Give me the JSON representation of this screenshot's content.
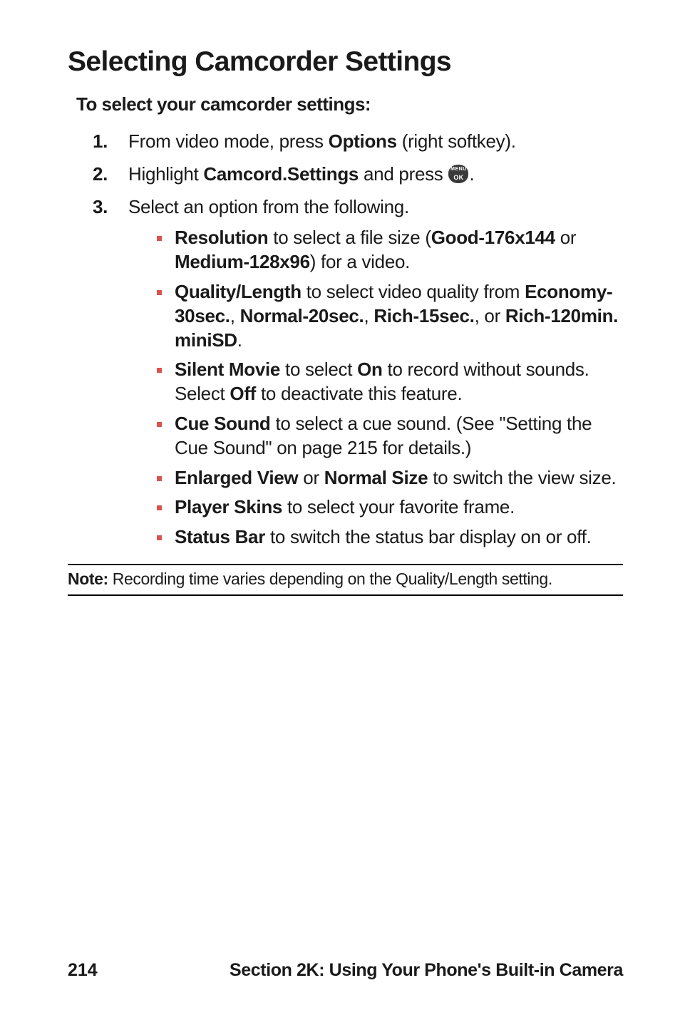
{
  "heading": "Selecting Camcorder Settings",
  "subheading": "To select your camcorder settings:",
  "step1": {
    "pre": "From video mode, press ",
    "bold": "Options",
    "post": " (right softkey)."
  },
  "step2": {
    "pre": "Highlight ",
    "bold": "Camcord.Settings",
    "mid": " and press ",
    "icon_top": "MENU",
    "icon_bot": "OK",
    "post": "."
  },
  "step3": {
    "text": "Select an option from the following."
  },
  "bullets": {
    "resolution": {
      "b1": "Resolution",
      "t1": " to select a file size (",
      "b2": "Good-176x144",
      "t2": " or ",
      "b3": "Medium-128x96",
      "t3": ") for a video."
    },
    "quality": {
      "b1": "Quality/Length",
      "t1": " to select video quality from ",
      "b2": "Economy-30sec.",
      "t2": ", ",
      "b3": "Normal-20sec.",
      "t3": ", ",
      "b4": "Rich-15sec.",
      "t4": ", or ",
      "b5": "Rich-120min. miniSD",
      "t5": "."
    },
    "silent": {
      "b1": "Silent Movie",
      "t1": " to select ",
      "b2": "On",
      "t2": " to record without sounds. Select ",
      "b3": "Off",
      "t3": " to deactivate this feature."
    },
    "cue": {
      "b1": "Cue Sound",
      "t1": " to select a cue sound. (See \"Setting the Cue Sound\" on page 215 for details.)"
    },
    "view": {
      "b1": "Enlarged View",
      "t1": " or ",
      "b2": "Normal Size",
      "t2": " to switch the view size."
    },
    "skins": {
      "b1": "Player Skins",
      "t1": " to select your favorite frame."
    },
    "status": {
      "b1": "Status Bar",
      "t1": " to switch the status bar display on or off."
    }
  },
  "note": {
    "label": "Note:",
    "text": " Recording time varies depending on the Quality/Length setting."
  },
  "footer": {
    "page": "214",
    "section": "Section 2K: Using Your Phone's Built-in Camera"
  }
}
